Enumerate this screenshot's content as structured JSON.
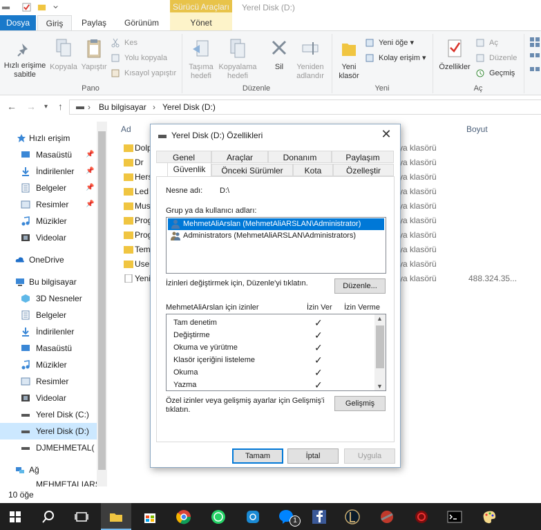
{
  "window": {
    "title": "Yerel Disk (D:)",
    "context_tab_group": "Sürücü Araçları"
  },
  "tabs": [
    "Dosya",
    "Giriş",
    "Paylaş",
    "Görünüm",
    "Yönet"
  ],
  "ribbon": {
    "pano": {
      "label": "Pano",
      "pin": "Hızlı erişime sabitle",
      "copy": "Kopyala",
      "paste": "Yapıştır",
      "cut": "Kes",
      "copy_path": "Yolu kopyala",
      "paste_shortcut": "Kısayol yapıştır"
    },
    "duzenle": {
      "label": "Düzenle",
      "move_to": "Taşıma hedefi",
      "copy_to": "Kopyalama hedefi",
      "delete": "Sil",
      "rename": "Yeniden adlandır"
    },
    "yeni": {
      "label": "Yeni",
      "new_folder": "Yeni klasör",
      "new_item": "Yeni öğe",
      "easy_access": "Kolay erişim"
    },
    "ac": {
      "label": "Aç",
      "properties": "Özellikler",
      "open": "Aç",
      "edit": "Düzenle",
      "history": "Geçmiş"
    }
  },
  "address": {
    "crumbs": [
      "Bu bilgisayar",
      "Yerel Disk (D:)"
    ],
    "separator": "›"
  },
  "sidebar": {
    "quick_access": "Hızlı erişim",
    "quick_items": [
      "Masaüstü",
      "İndirilenler",
      "Belgeler",
      "Resimler",
      "Müzikler",
      "Videolar"
    ],
    "onedrive": "OneDrive",
    "this_pc": "Bu bilgisayar",
    "pc_items": [
      "3D Nesneler",
      "Belgeler",
      "İndirilenler",
      "Masaüstü",
      "Müzikler",
      "Resimler",
      "Videolar",
      "Yerel Disk (C:)",
      "Yerel Disk (D:)",
      "DJMEHMETAL( ("
    ],
    "network": "Ağ",
    "network_items": [
      "MEHMETALIARS"
    ]
  },
  "file_list": {
    "col_name": "Ad",
    "col_size": "Boyut",
    "rows": [
      {
        "name": "Dolp",
        "type": "ya klasörü",
        "size": ""
      },
      {
        "name": "Dr",
        "type": "ya klasörü",
        "size": ""
      },
      {
        "name": "Hers",
        "type": "ya klasörü",
        "size": ""
      },
      {
        "name": "Led",
        "type": "ya klasörü",
        "size": ""
      },
      {
        "name": "Mus",
        "type": "ya klasörü",
        "size": ""
      },
      {
        "name": "Prog",
        "type": "ya klasörü",
        "size": ""
      },
      {
        "name": "Prog",
        "type": "ya klasörü",
        "size": ""
      },
      {
        "name": "Tem",
        "type": "ya klasörü",
        "size": ""
      },
      {
        "name": "User",
        "type": "ya klasörü",
        "size": ""
      },
      {
        "name": "Yeni",
        "type": "ya klasörü",
        "size": "488.324.35..."
      }
    ]
  },
  "status": {
    "count": "10 öğe"
  },
  "dialog": {
    "title": "Yerel Disk (D:) Özellikleri",
    "tabs_row1": [
      "Genel",
      "Araçlar",
      "Donanım",
      "Paylaşım"
    ],
    "tabs_row2": [
      "Güvenlik",
      "Önceki Sürümler",
      "Kota",
      "Özelleştir"
    ],
    "object_label": "Nesne adı:",
    "object_value": "D:\\",
    "group_label": "Grup ya da kullanıcı adları:",
    "users": [
      "MehmetAliArslan (MehmetAliARSLAN\\Administrator)",
      "Administrators (MehmetAliARSLAN\\Administrators)"
    ],
    "change_hint": "İzinleri değiştirmek için, Düzenle'yi tıklatın.",
    "edit_button": "Düzenle...",
    "perm_header": "MehmetAliArslan için izinler",
    "allow_header": "İzin Ver",
    "deny_header": "İzin Verme",
    "permissions": [
      {
        "name": "Tam denetim",
        "allow": "✓"
      },
      {
        "name": "Değiştirme",
        "allow": "✓"
      },
      {
        "name": "Okuma ve yürütme",
        "allow": "✓"
      },
      {
        "name": "Klasör içeriğini listeleme",
        "allow": "✓"
      },
      {
        "name": "Okuma",
        "allow": "✓"
      },
      {
        "name": "Yazma",
        "allow": "✓"
      }
    ],
    "advanced_hint_1": "Özel izinler veya gelişmiş ayarlar için Gelişmiş'i",
    "advanced_hint_2": "tıklatın.",
    "advanced_button": "Gelişmiş",
    "ok": "Tamam",
    "cancel": "İptal",
    "apply": "Uygula",
    "close_glyph": "✕"
  },
  "taskbar": {
    "badge": "1"
  },
  "colors": {
    "accent": "#0078d7",
    "file_tab": "#1979ca",
    "folder": "#f0c541",
    "context": "#e8c34a"
  }
}
